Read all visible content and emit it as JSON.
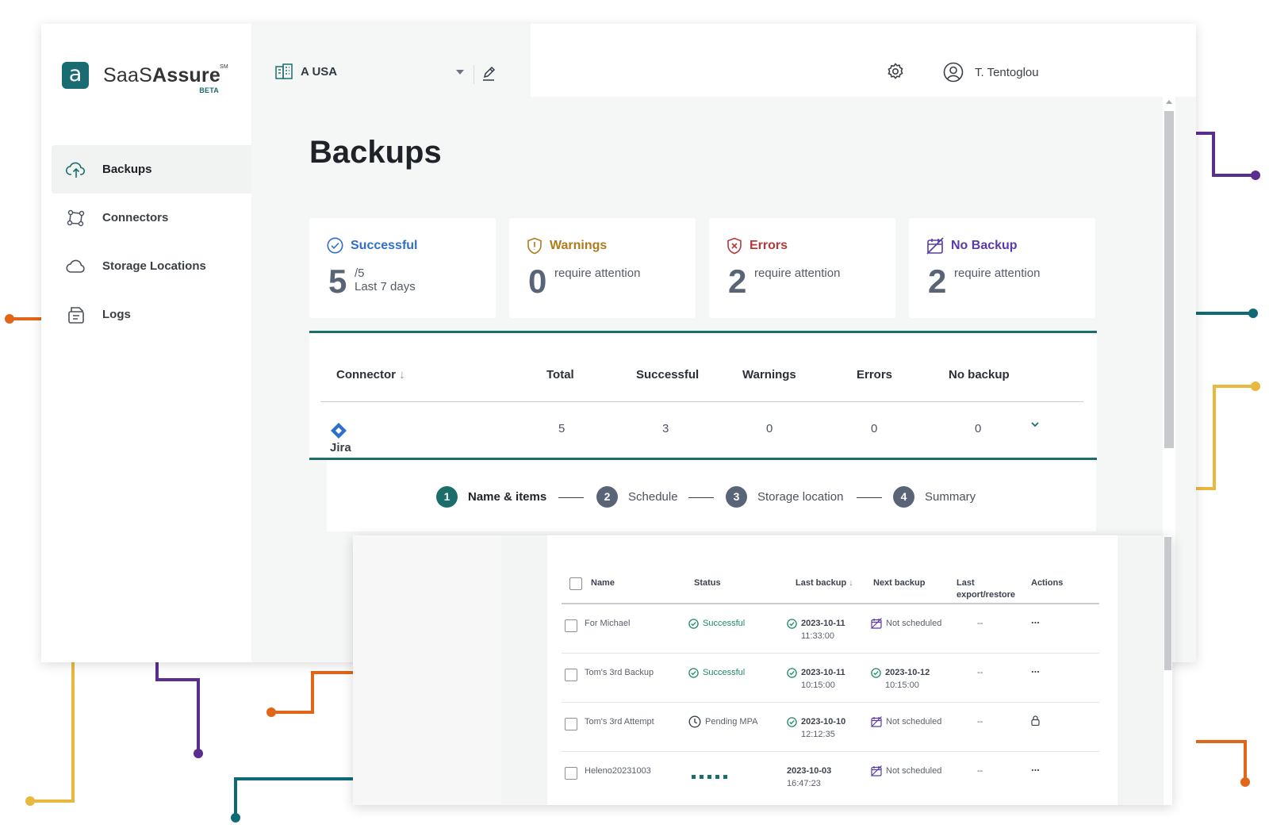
{
  "brand": {
    "name_light": "SaaS",
    "name_bold": "Assure",
    "sm": "SM",
    "beta": "BETA",
    "mark": "a",
    "color": "#1b6b72"
  },
  "org": {
    "name": "A USA"
  },
  "user": {
    "name": "T. Tentoglou"
  },
  "sidebar": {
    "items": [
      {
        "label": "Backups",
        "icon": "cloud-upload-icon",
        "active": true
      },
      {
        "label": "Connectors",
        "icon": "connectors-icon"
      },
      {
        "label": "Storage Locations",
        "icon": "cloud-icon"
      },
      {
        "label": "Logs",
        "icon": "logs-icon"
      }
    ]
  },
  "page": {
    "title": "Backups"
  },
  "cards": [
    {
      "label": "Successful",
      "number": "5",
      "sub1": "/5",
      "sub2": "Last 7 days",
      "color": "#2f6fca",
      "icon": "check-circle-icon"
    },
    {
      "label": "Warnings",
      "number": "0",
      "sub1": "require attention",
      "color": "#b07a1c",
      "icon": "shield-exclamation-icon"
    },
    {
      "label": "Errors",
      "number": "2",
      "sub1": "require attention",
      "color": "#b43a3a",
      "icon": "shield-x-icon"
    },
    {
      "label": "No Backup",
      "number": "2",
      "sub1": "require attention",
      "color": "#5a3aa8",
      "icon": "calendar-off-icon"
    }
  ],
  "summary": {
    "headers": {
      "connector": "Connector",
      "total": "Total",
      "successful": "Successful",
      "warnings": "Warnings",
      "errors": "Errors",
      "no_backup": "No backup"
    },
    "row": {
      "connector": "Jira",
      "total": "5",
      "successful": "3",
      "warnings": "0",
      "errors": "0",
      "no_backup": "0"
    }
  },
  "steps": [
    {
      "n": "1",
      "label": "Name & items"
    },
    {
      "n": "2",
      "label": "Schedule"
    },
    {
      "n": "3",
      "label": "Storage location"
    },
    {
      "n": "4",
      "label": "Summary"
    }
  ],
  "backups": {
    "headers": {
      "name": "Name",
      "status": "Status",
      "last_backup": "Last backup",
      "next_backup": "Next backup",
      "last_export_1": "Last",
      "last_export_2": "export/restore",
      "actions": "Actions"
    },
    "rows": [
      {
        "name": "For Michael",
        "status": "Successful",
        "last_date": "2023-10-11",
        "last_time": "11:33:00",
        "next": "Not scheduled",
        "next_time": "",
        "export": "--",
        "action": "..."
      },
      {
        "name": "Tom's 3rd Backup",
        "status": "Successful",
        "last_date": "2023-10-11",
        "last_time": "10:15:00",
        "next": "2023-10-12",
        "next_time": "10:15:00",
        "export": "--",
        "action": "..."
      },
      {
        "name": "Tom's 3rd Attempt",
        "status": "Pending MPA",
        "last_date": "2023-10-10",
        "last_time": "12:12:35",
        "next": "Not scheduled",
        "next_time": "",
        "export": "--",
        "action": "lock"
      },
      {
        "name": "Heleno20231003",
        "status": "in-progress",
        "last_date": "2023-10-03",
        "last_time": "16:47:23",
        "next": "Not scheduled",
        "next_time": "",
        "export": "--",
        "action": "..."
      }
    ]
  },
  "decor_colors": {
    "purple": "#5b2d8e",
    "teal": "#0f6a78",
    "yellow": "#e8b93e",
    "orange": "#e2661a"
  }
}
